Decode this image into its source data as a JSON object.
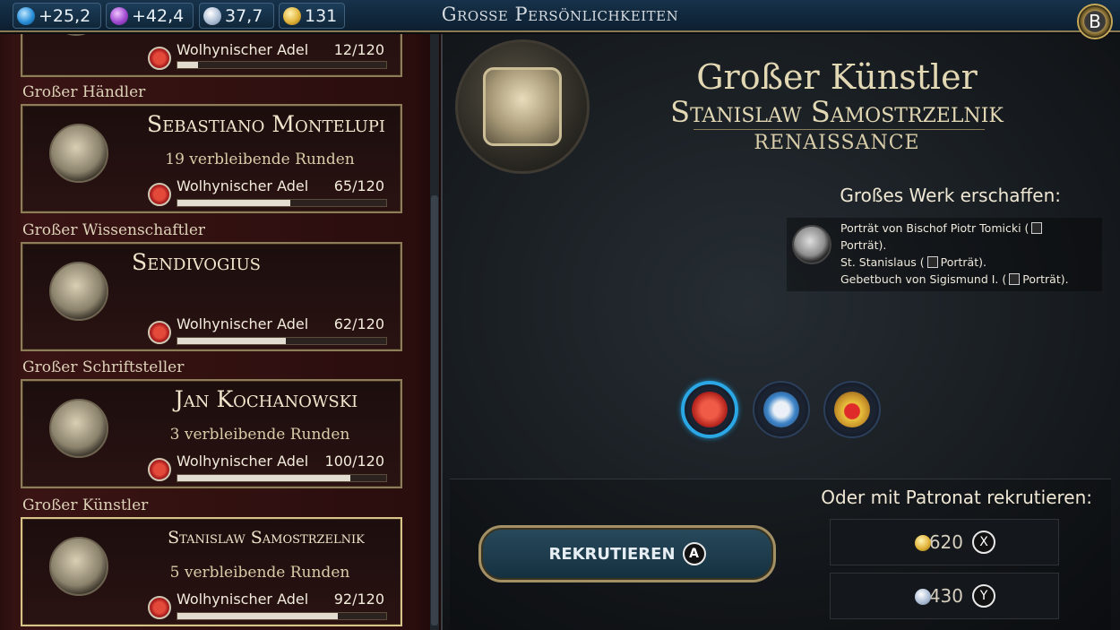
{
  "topbar": {
    "resources": [
      {
        "icon": "science-icon",
        "value": "+25,2"
      },
      {
        "icon": "culture-icon",
        "value": "+42,4"
      },
      {
        "icon": "faith-icon",
        "value": "37,7"
      },
      {
        "icon": "gold-icon",
        "value": "131"
      }
    ],
    "title": "Grosse Persönlichkeiten",
    "back_button": "B"
  },
  "list": {
    "top_card": {
      "civ": "Wolhynischer Adel",
      "points": "12/120",
      "progress": 0.1
    },
    "cards": [
      {
        "category": "Großer Händler",
        "name": "Sebastiano Montelupi",
        "turns": "19 verbleibende Runden",
        "civ": "Wolhynischer Adel",
        "points": "65/120",
        "progress": 0.54
      },
      {
        "category": "Großer Wissenschaftler",
        "name": "Sendivogius",
        "turns": "",
        "civ": "Wolhynischer Adel",
        "points": "62/120",
        "progress": 0.52
      },
      {
        "category": "Großer Schriftsteller",
        "name": "Jan Kochanowski",
        "turns": "3 verbleibende Runden",
        "civ": "Wolhynischer Adel",
        "points": "100/120",
        "progress": 0.83
      },
      {
        "category": "Großer Künstler",
        "name": "Stanislaw Samostrzelnik",
        "turns": "5 verbleibende Runden",
        "civ": "Wolhynischer Adel",
        "points": "92/120",
        "progress": 0.77
      }
    ]
  },
  "detail": {
    "type": "Großer Künstler",
    "name": "Stanislaw Samostrzelnik",
    "era": "RENAISSANCE",
    "great_works_heading": "Großes Werk erschaffen:",
    "works": {
      "w1a": "Porträt von Bischof Piotr Tomicki (",
      "w1b": "Porträt).",
      "w2a": "St. Stanislaus (",
      "w2b": "Porträt).",
      "w3a": "Gebetbuch von Sigismund I. (",
      "w3b": "Porträt)."
    },
    "patronage_heading": "Oder mit Patronat rekrutieren:",
    "recruit_label": "REKRUTIEREN",
    "recruit_key": "A",
    "costs": [
      {
        "value": "620",
        "currency": "gold-icon",
        "key": "X"
      },
      {
        "value": "430",
        "currency": "faith-icon",
        "key": "Y"
      }
    ]
  }
}
